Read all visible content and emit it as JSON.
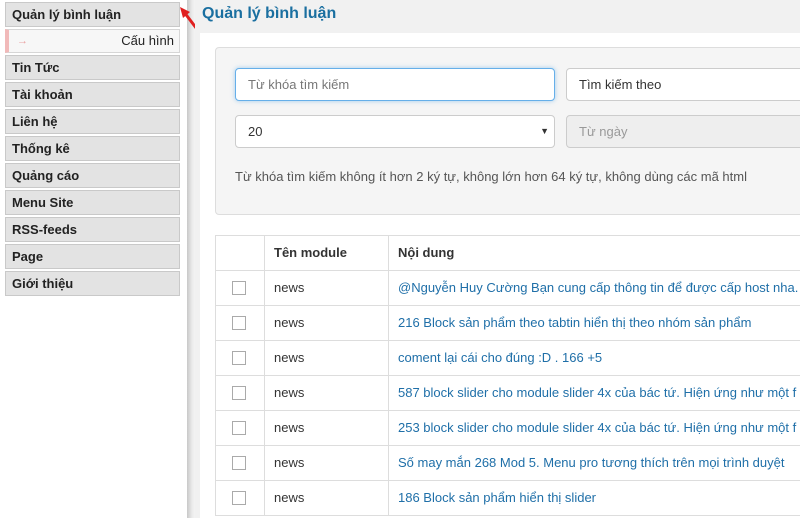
{
  "sidebar": {
    "items": [
      {
        "label": "Quản lý bình luận"
      },
      {
        "label": "Tin Tức"
      },
      {
        "label": "Tài khoản"
      },
      {
        "label": "Liên hệ"
      },
      {
        "label": "Thống kê"
      },
      {
        "label": "Quảng cáo"
      },
      {
        "label": "Menu Site"
      },
      {
        "label": "RSS-feeds"
      },
      {
        "label": "Page"
      },
      {
        "label": "Giới thiệu"
      }
    ],
    "sub_item": {
      "label": "Cấu hình",
      "arrow": "→"
    }
  },
  "main": {
    "title": "Quản lý bình luận",
    "search": {
      "keyword_placeholder": "Từ khóa tìm kiếm",
      "search_by": "Tìm kiếm theo",
      "per_page": "20",
      "from_date_placeholder": "Từ ngày",
      "help": "Từ khóa tìm kiếm không ít hơn 2 ký tự, không lớn hơn 64 ký tự, không dùng các mã html"
    },
    "table": {
      "headers": {
        "module": "Tên module",
        "content": "Nội dung"
      },
      "rows": [
        {
          "module": "news",
          "content": "@Nguyễn Huy Cường Bạn cung cấp thông tin để được cấp host nha."
        },
        {
          "module": "news",
          "content": "216 Block sản phẩm theo tabtin hiển thị theo nhóm sản phẩm"
        },
        {
          "module": "news",
          "content": "coment lại cái cho đúng :D . 166 +5"
        },
        {
          "module": "news",
          "content": "587 block slider cho module slider 4x của bác tứ. Hiện ứng như một f"
        },
        {
          "module": "news",
          "content": "253 block slider cho module slider 4x của bác tứ. Hiện ứng như một f"
        },
        {
          "module": "news",
          "content": "Số may mắn 268 Mod 5. Menu pro tương thích trên mọi trình duyệt"
        },
        {
          "module": "news",
          "content": "186 Block sản phẩm hiển thị slider"
        }
      ]
    }
  },
  "colors": {
    "accent": "#1a6fa0",
    "link": "#1f6fa8",
    "annotation_arrow": "#e02020"
  }
}
